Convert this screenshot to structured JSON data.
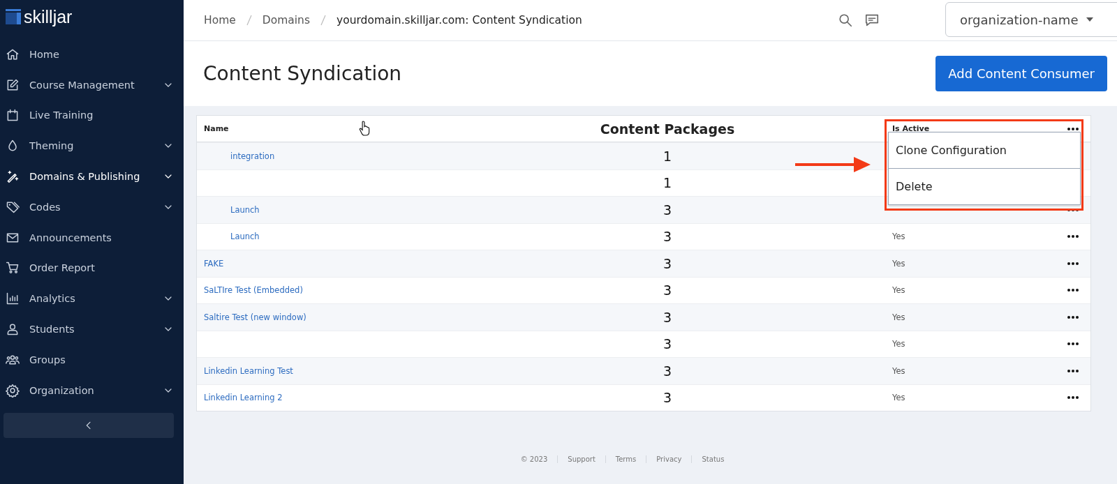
{
  "sidebar": {
    "logo": "skilljar",
    "items": [
      {
        "label": "Home",
        "expandable": false,
        "selected": false
      },
      {
        "label": "Course Management",
        "expandable": true,
        "selected": false
      },
      {
        "label": "Live Training",
        "expandable": false,
        "selected": false
      },
      {
        "label": "Theming",
        "expandable": true,
        "selected": false
      },
      {
        "label": "Domains & Publishing",
        "expandable": true,
        "selected": true
      },
      {
        "label": "Codes",
        "expandable": true,
        "selected": false
      },
      {
        "label": "Announcements",
        "expandable": false,
        "selected": false
      },
      {
        "label": "Order Report",
        "expandable": false,
        "selected": false
      },
      {
        "label": "Analytics",
        "expandable": true,
        "selected": false
      },
      {
        "label": "Students",
        "expandable": true,
        "selected": false
      },
      {
        "label": "Groups",
        "expandable": false,
        "selected": false
      },
      {
        "label": "Organization",
        "expandable": true,
        "selected": false
      }
    ]
  },
  "breadcrumbs": [
    "Home",
    "Domains",
    "yourdomain.skilljar.com: Content Syndication"
  ],
  "org_select": {
    "value": "organization-name"
  },
  "page_title": "Content Syndication",
  "primary_button": "Add Content Consumer",
  "table": {
    "columns": [
      "Name",
      "Content Packages",
      "Is Active"
    ],
    "rows": [
      {
        "name": "integration",
        "packages": "1"
      },
      {
        "packages": "1"
      },
      {
        "name": "Launch",
        "packages": "3"
      },
      {
        "name": "Launch",
        "packages": "3",
        "active": "Yes"
      },
      {
        "name": "FAKE",
        "packages": "3",
        "active": "Yes"
      },
      {
        "name": "SaLTIre Test (Embedded)",
        "packages": "3",
        "active": "Yes"
      },
      {
        "name": "Saltire Test (new window)",
        "packages": "3",
        "active": "Yes"
      },
      {
        "packages": "3",
        "active": "Yes"
      },
      {
        "name": "Linkedin Learning Test",
        "packages": "3",
        "active": "Yes"
      },
      {
        "name": "Linkedin Learning 2",
        "packages": "3",
        "active": "Yes"
      }
    ]
  },
  "row_menu": [
    "Clone Configuration",
    "Delete"
  ],
  "footer": [
    "© 2023",
    "Support",
    "Terms",
    "Privacy",
    "Status"
  ]
}
